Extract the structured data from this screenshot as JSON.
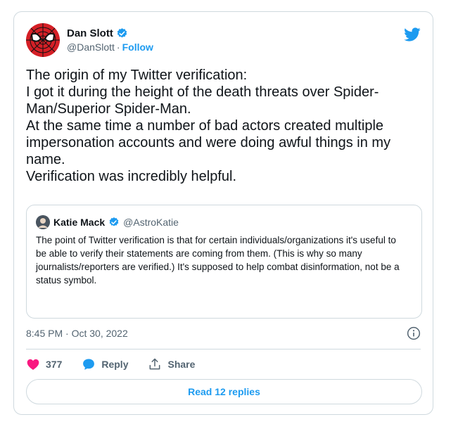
{
  "tweet": {
    "author": {
      "name": "Dan Slott",
      "handle": "@DanSlott",
      "separator": "·",
      "follow_label": "Follow",
      "avatar_icon": "spider-man-mask-icon"
    },
    "text_lines": [
      "The origin of my Twitter verification:",
      "I got it during the height of the death threats over Spider-Man/Superior Spider-Man.",
      "At the same time a number of bad actors created multiple impersonation accounts and were doing awful things in my name.",
      "Verification was incredibly helpful."
    ],
    "quote": {
      "name": "Katie Mack",
      "handle": "@AstroKatie",
      "text": "The point of Twitter verification is that for certain individuals/organizations it's useful to be able to verify their statements are coming from them. (This is why so many journalists/reporters are verified.) It's supposed to help combat disinformation, not be a status symbol."
    },
    "timestamp": "8:45 PM · Oct 30, 2022",
    "actions": {
      "like_count": "377",
      "reply_label": "Reply",
      "share_label": "Share"
    },
    "read_replies_label": "Read 12 replies"
  },
  "colors": {
    "accent": "#1d9bf0",
    "like": "#f91880",
    "border": "#cfd9de",
    "secondary_text": "#536471",
    "primary_text": "#0f1419",
    "avatar_red": "#d51f26"
  }
}
